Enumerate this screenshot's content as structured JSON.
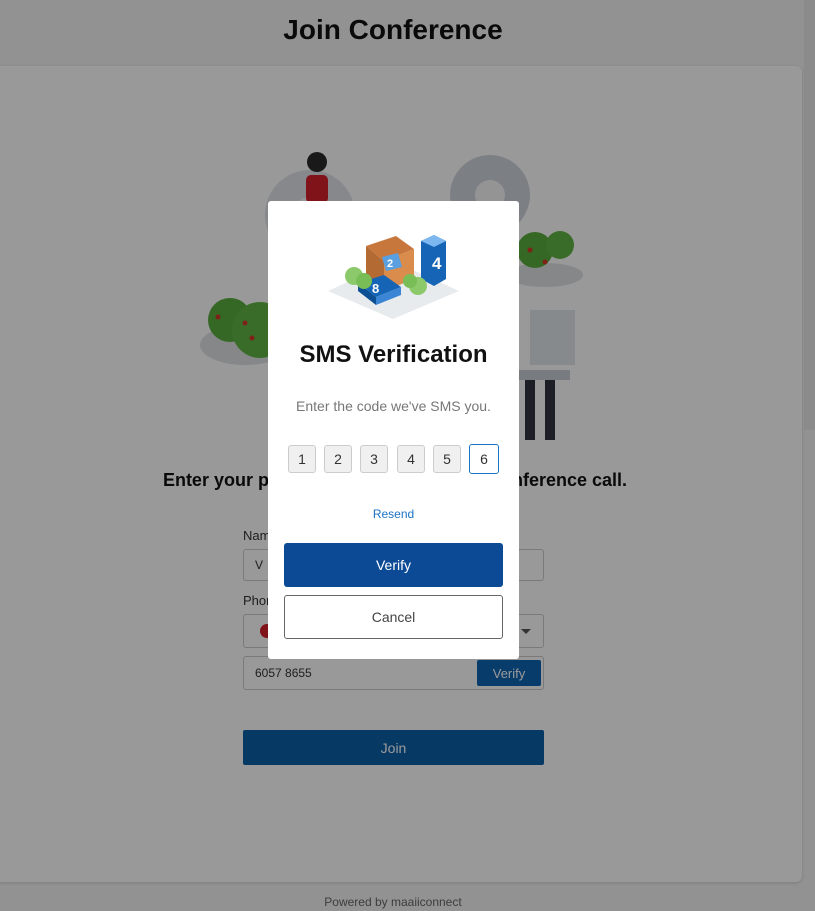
{
  "page": {
    "title": "Join Conference",
    "instruction": "Enter your personal details to join the conference call.",
    "footer": "Powered by maaiiconnect"
  },
  "form": {
    "name_label": "Name",
    "name_value": "V",
    "phone_label": "Phone",
    "phone_value": "6057 8655",
    "verify_label": "Verify",
    "join_label": "Join"
  },
  "modal": {
    "title": "SMS Verification",
    "subtitle": "Enter the code we've SMS you.",
    "code_digits": [
      "1",
      "2",
      "3",
      "4",
      "5",
      "6"
    ],
    "resend_label": "Resend",
    "verify_label": "Verify",
    "cancel_label": "Cancel",
    "hero_numbers": [
      "2",
      "4",
      "8"
    ]
  },
  "colors": {
    "primary": "#0d4a96",
    "link": "#1a73c6",
    "overlay": "rgba(0,0,0,0.4)"
  },
  "icons": {
    "flag": "hong-kong-flag-icon",
    "dropdown": "chevron-down-icon"
  }
}
